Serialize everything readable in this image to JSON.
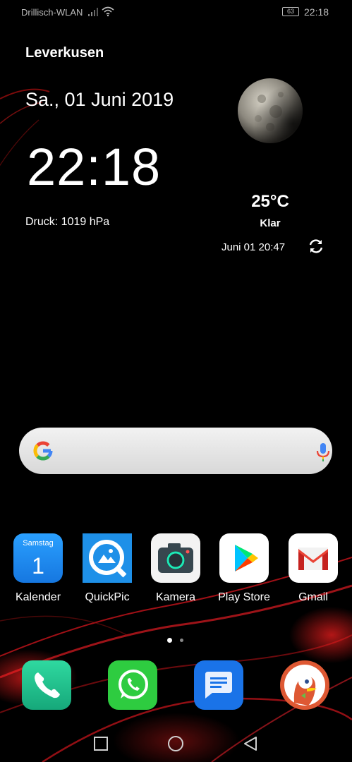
{
  "status_bar": {
    "carrier": "Drillisch-WLAN",
    "battery": "63",
    "time": "22:18",
    "icons": [
      "signal-icon",
      "wifi-icon",
      "battery-icon"
    ]
  },
  "widget": {
    "location": "Leverkusen",
    "date": "Sa., 01 Juni 2019",
    "time": "22:18",
    "pressure": "Druck: 1019 hPa",
    "temperature": "25°C",
    "condition": "Klar",
    "updated": "Juni 01  20:47",
    "icons": [
      "moon-icon",
      "refresh-icon"
    ]
  },
  "search": {
    "icons": [
      "google-icon",
      "microphone-icon"
    ]
  },
  "apps": [
    {
      "label": "Kalender",
      "icon": "calendar-icon",
      "day_name": "Samstag",
      "day_number": "1"
    },
    {
      "label": "QuickPic",
      "icon": "quickpic-icon"
    },
    {
      "label": "Kamera",
      "icon": "camera-icon"
    },
    {
      "label": "Play Store",
      "icon": "play-store-icon"
    },
    {
      "label": "Gmail",
      "icon": "gmail-icon"
    }
  ],
  "page_indicator": {
    "pages": 2,
    "current": 1
  },
  "dock": [
    {
      "icon": "phone-icon"
    },
    {
      "icon": "whatsapp-icon"
    },
    {
      "icon": "messages-icon"
    },
    {
      "icon": "duckduckgo-icon"
    }
  ],
  "navigation": {
    "icons": [
      "recents-icon",
      "home-icon",
      "back-icon"
    ]
  },
  "colors": {
    "background": "#000000",
    "wallpaper_accent": "#c8141b",
    "calendar_blue": "#1a8cf0",
    "quickpic_blue": "#1e90e8",
    "phone_green": "#25c08a",
    "whatsapp_green": "#2ecc40",
    "messages_blue": "#1a73e8",
    "duckduckgo_orange": "#de5833"
  }
}
